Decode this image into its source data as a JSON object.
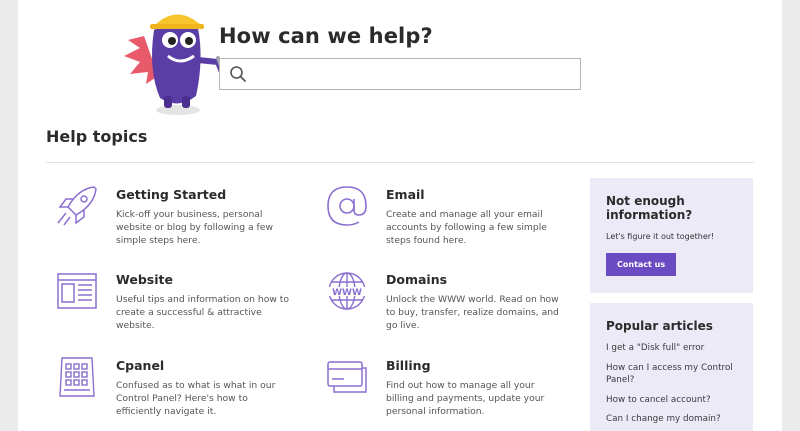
{
  "hero": {
    "title": "How can we help?",
    "search_placeholder": "",
    "search_value": ""
  },
  "help_topics": {
    "title": "Help topics",
    "items": [
      {
        "name": "Getting Started",
        "desc": "Kick-off your business, personal website or blog by following a few simple steps here.",
        "icon": "rocket-icon"
      },
      {
        "name": "Email",
        "desc": "Create and manage all your email accounts by following a few simple steps found here.",
        "icon": "at-sign-icon"
      },
      {
        "name": "Website",
        "desc": "Useful tips and information on how to create a successful & attractive website.",
        "icon": "webpage-icon"
      },
      {
        "name": "Domains",
        "desc": "Unlock the WWW world. Read on how to buy, transfer, realize domains, and go live.",
        "icon": "globe-www-icon"
      },
      {
        "name": "Cpanel",
        "desc": "Confused as to what is what in our Control Panel? Here's how to efficiently navigate it.",
        "icon": "control-panel-icon"
      },
      {
        "name": "Billing",
        "desc": "Find out how to manage all your billing and payments, update your personal information.",
        "icon": "credit-card-icon"
      }
    ]
  },
  "sidebar": {
    "contact_box": {
      "title": "Not enough information?",
      "subtitle": "Let's figure it out together!",
      "button": "Contact us"
    },
    "popular": {
      "title": "Popular articles",
      "articles": [
        "I get a \"Disk full\" error",
        "How can I access my Control Panel?",
        "How to cancel account?",
        "Can I change my domain?"
      ]
    }
  },
  "colors": {
    "accent": "#6a4bc1",
    "icon_stroke": "#8a6fcf",
    "panel_bg": "#edeaf8",
    "mascot_body": "#5b3da6",
    "helmet": "#f7c52b"
  }
}
